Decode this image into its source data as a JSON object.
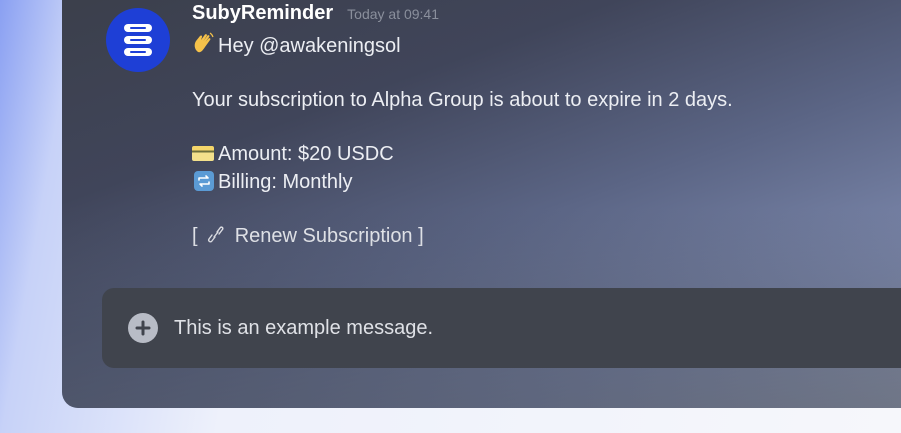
{
  "message": {
    "username": "SubyReminder",
    "timestamp": "Today at 09:41",
    "greeting": "Hey @awakeningsol",
    "body": "Your subscription to Alpha Group is about to expire in 2 days.",
    "amount": "Amount: $20 USDC",
    "billing": "Billing: Monthly",
    "link_open": "[",
    "link_text": "Renew Subscription ]"
  },
  "composer": {
    "text": "This is an example message."
  },
  "icons": {
    "avatar": "database-stack-icon",
    "greeting": "waving-hand-icon",
    "amount": "credit-card-icon",
    "billing": "repeat-icon",
    "link": "link-icon",
    "composer": "plus-icon"
  },
  "colors": {
    "avatar_bg": "#1e3fd6",
    "composer_bg": "#40444d"
  }
}
